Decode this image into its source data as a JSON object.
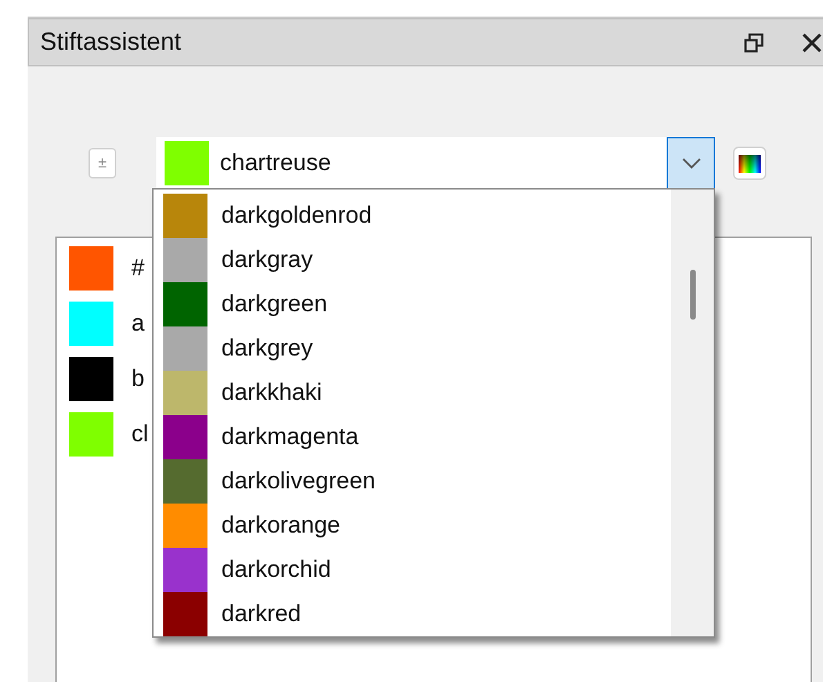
{
  "panel": {
    "title": "Stiftassistent"
  },
  "toggle_button": {
    "label": "±"
  },
  "combo": {
    "value": "chartreuse",
    "color": "#7fff00",
    "expanded": true
  },
  "dropdown": {
    "items": [
      {
        "label": "darkgoldenrod",
        "color": "#b8860b"
      },
      {
        "label": "darkgray",
        "color": "#a9a9a9"
      },
      {
        "label": "darkgreen",
        "color": "#006400"
      },
      {
        "label": "darkgrey",
        "color": "#a9a9a9"
      },
      {
        "label": "darkkhaki",
        "color": "#bdb76b"
      },
      {
        "label": "darkmagenta",
        "color": "#8b008b"
      },
      {
        "label": "darkolivegreen",
        "color": "#556b2f"
      },
      {
        "label": "darkorange",
        "color": "#ff8c00"
      },
      {
        "label": "darkorchid",
        "color": "#9932cc"
      },
      {
        "label": "darkred",
        "color": "#8b0000"
      }
    ]
  },
  "pen_list": {
    "items": [
      {
        "label": "#",
        "color": "#ff5500"
      },
      {
        "label": "a",
        "color": "#00ffff"
      },
      {
        "label": "b",
        "color": "#000000"
      },
      {
        "label": "cl",
        "color": "#7fff00"
      }
    ]
  }
}
